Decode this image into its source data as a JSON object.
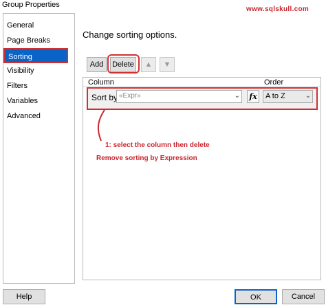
{
  "window": {
    "title": "Group Properties"
  },
  "watermark": "www.sqlskull.com",
  "sidebar": {
    "items": [
      {
        "label": "General"
      },
      {
        "label": "Page Breaks"
      },
      {
        "label": "Sorting"
      },
      {
        "label": "Visibility"
      },
      {
        "label": "Filters"
      },
      {
        "label": "Variables"
      },
      {
        "label": "Advanced"
      }
    ],
    "selected": "Sorting"
  },
  "main": {
    "heading": "Change sorting options.",
    "toolbar": {
      "add_label": "Add",
      "delete_label": "Delete",
      "move_up_icon": "arrow-up-icon",
      "move_down_icon": "arrow-down-icon"
    },
    "grid": {
      "columns": [
        "Column",
        "Order"
      ],
      "rows": [
        {
          "label": "Sort by",
          "expression": "«Expr»",
          "fx": "fx",
          "order": "A to Z"
        }
      ]
    }
  },
  "annotations": {
    "step1": "1: select the column then delete",
    "caption": "Remove sorting by Expression",
    "color": "#c8262e"
  },
  "footer": {
    "help_label": "Help",
    "ok_label": "OK",
    "cancel_label": "Cancel"
  }
}
